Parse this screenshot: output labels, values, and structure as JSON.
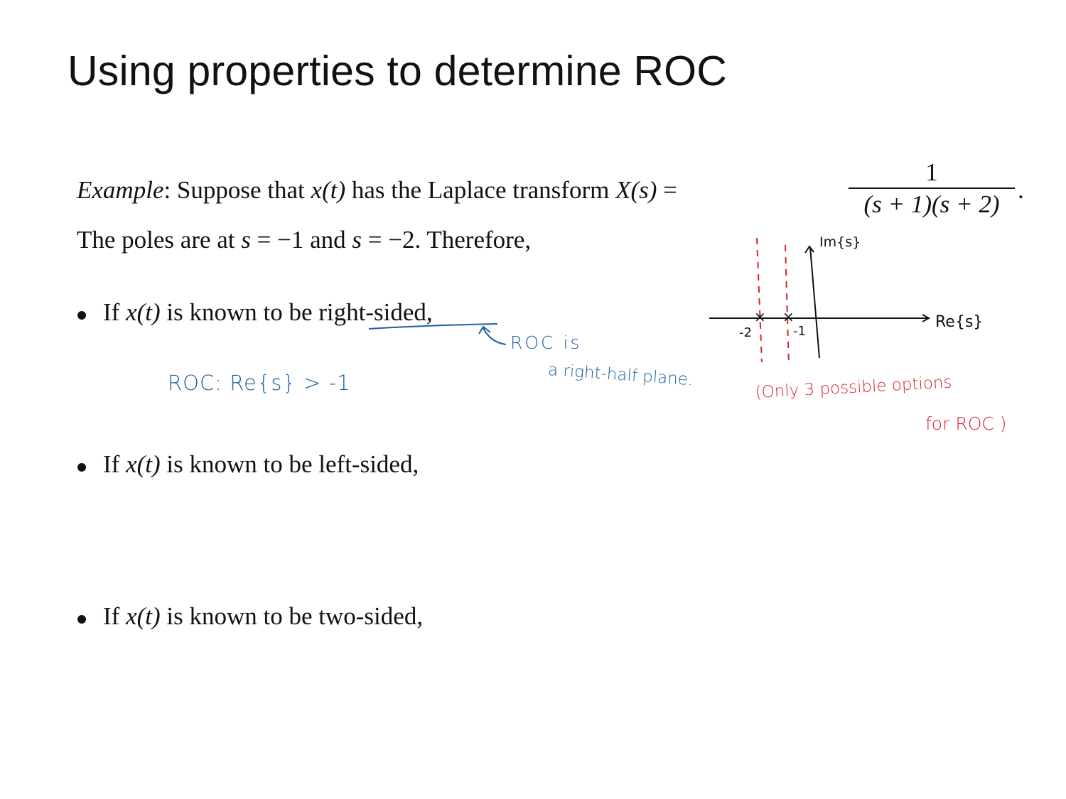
{
  "slide": {
    "title": "Using properties to determine ROC"
  },
  "example": {
    "label": "Example",
    "text_1": ": Suppose that ",
    "xt": "x(t)",
    "text_2": " has the Laplace transform ",
    "Xs": "X(s)",
    "eq": " = ",
    "numerator": "1",
    "denominator": "(s + 1)(s + 2)",
    "end": "."
  },
  "poles_line": {
    "text_1": "The poles are at ",
    "s1": "s",
    "eq1": " = −1 and ",
    "s2": "s",
    "eq2": " = −2.  Therefore,"
  },
  "bullets": [
    {
      "prefix": "If ",
      "var": "x(t)",
      "middle": " is known to be ",
      "kind": "right-sided",
      "suffix": ","
    },
    {
      "prefix": "If ",
      "var": "x(t)",
      "middle": " is known to be ",
      "kind": "left-sided",
      "suffix": ","
    },
    {
      "prefix": "If ",
      "var": "x(t)",
      "middle": " is known to be ",
      "kind": "two-sided",
      "suffix": ","
    }
  ],
  "annotations": {
    "roc_is": "ROC is",
    "right_half_plane": "a right-half plane.",
    "roc_answer": "ROC:  Re{s} > -1",
    "only_options_1": "(Only  3 possible options",
    "only_options_2": "for ROC )"
  },
  "pole_zero_plot": {
    "im_label": "Im{s}",
    "re_label": "Re{s}",
    "pole_label_1": "-2",
    "pole_label_2": "-1",
    "poles": [
      -2,
      -1
    ],
    "marker": "×"
  },
  "colors": {
    "ink_blue": "#1f5f9e",
    "ink_red": "#d9232d",
    "ink_black": "#111111"
  }
}
